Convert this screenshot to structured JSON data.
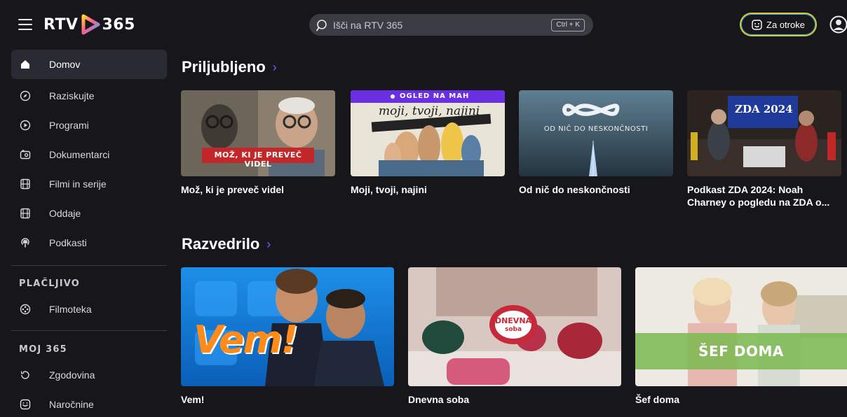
{
  "header": {
    "logo_left": "RTV",
    "logo_right": "365",
    "search_placeholder": "Išči na RTV 365",
    "search_shortcut": "Ctrl + K",
    "kids_label": "Za otroke"
  },
  "sidebar": {
    "items": [
      {
        "label": "Domov",
        "icon": "home-icon"
      },
      {
        "label": "Raziskujte",
        "icon": "compass-icon"
      },
      {
        "label": "Programi",
        "icon": "play-circle-icon"
      },
      {
        "label": "Dokumentarci",
        "icon": "camera-icon"
      },
      {
        "label": "Filmi in serije",
        "icon": "film-icon"
      },
      {
        "label": "Oddaje",
        "icon": "film-icon"
      },
      {
        "label": "Podkasti",
        "icon": "podcast-icon"
      }
    ],
    "paid_section": "PLAČLJIVO",
    "paid_items": [
      {
        "label": "Filmoteka",
        "icon": "film-reel-icon"
      }
    ],
    "my_section": "MOJ 365",
    "my_items": [
      {
        "label": "Zgodovina",
        "icon": "history-icon"
      },
      {
        "label": "Naročnine",
        "icon": "subscription-icon"
      }
    ]
  },
  "rows": [
    {
      "title": "Priljubljeno",
      "cards": [
        {
          "title": "Mož, ki je preveč videl",
          "overlay": "MOŽ, KI JE PREVEČ VIDEL"
        },
        {
          "title": "Moji, tvoji, najini",
          "overlay": "OGLED NA MAH",
          "overlay2": "moji, tvoji, najini"
        },
        {
          "title": "Od nič do neskončnosti",
          "overlay": "OD NIČ DO NESKONČNOSTI"
        },
        {
          "title": "Podkast ZDA 2024: Noah Charney o pogledu na ZDA o...",
          "overlay": "ZDA 2024"
        }
      ]
    },
    {
      "title": "Razvedrilo",
      "cards": [
        {
          "title": "Vem!",
          "overlay": "Vem!"
        },
        {
          "title": "Dnevna soba",
          "overlay": "DNEVNA",
          "overlay2": "soba"
        },
        {
          "title": "Šef doma",
          "overlay": "ŠEF DOMA"
        }
      ]
    }
  ],
  "colors": {
    "background": "#16161b",
    "accent": "#7c5cff",
    "sidebar_active": "#2a2a32",
    "search_bg": "#3b3b43"
  }
}
